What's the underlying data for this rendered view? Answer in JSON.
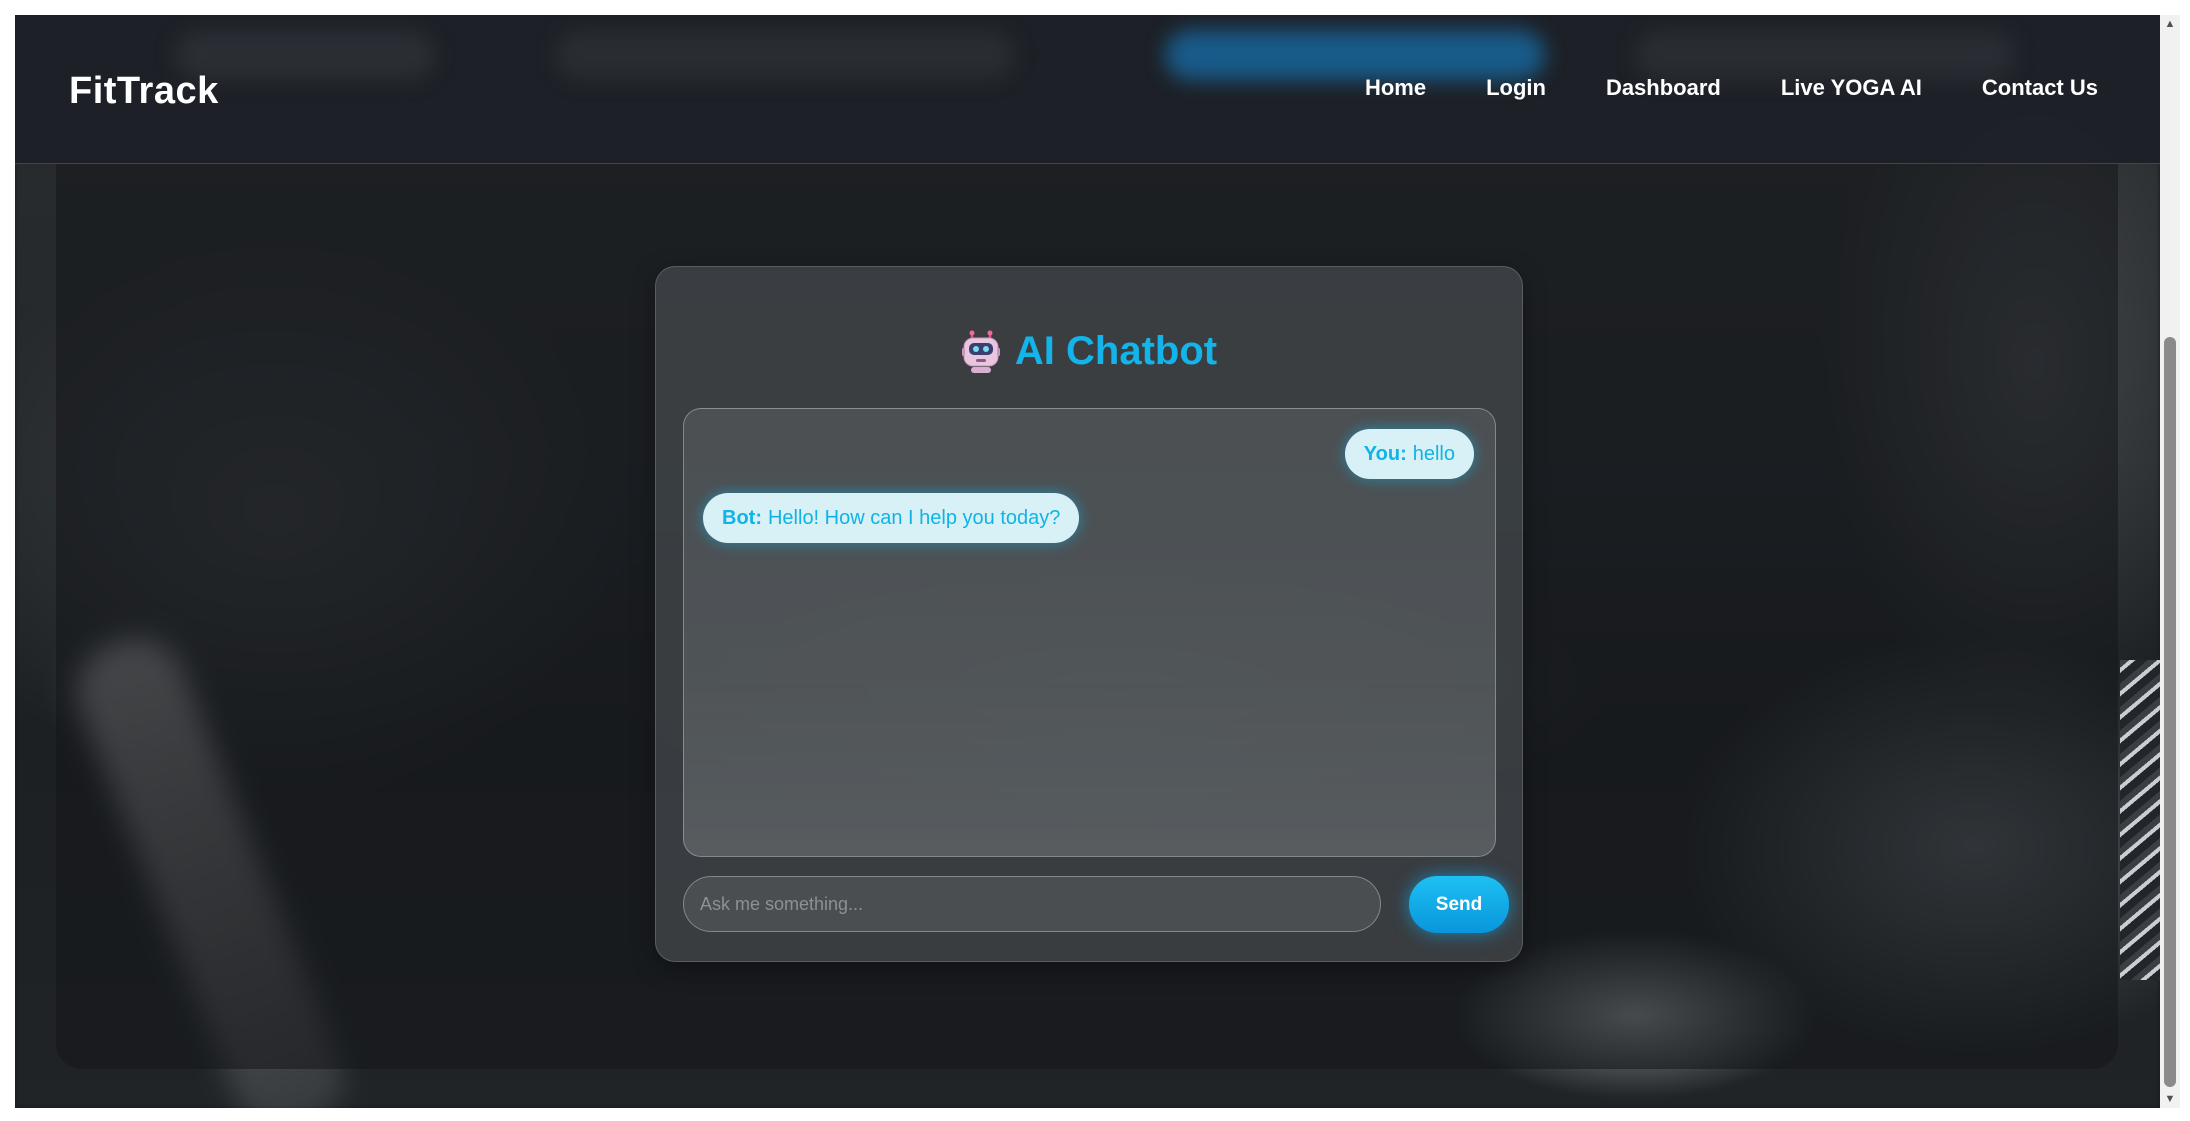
{
  "navbar": {
    "logo": "FitTrack",
    "links": [
      "Home",
      "Login",
      "Dashboard",
      "Live YOGA AI",
      "Contact Us"
    ]
  },
  "chatbot": {
    "icon": "robot-icon",
    "title": "AI Chatbot",
    "messages": [
      {
        "sender": "You:",
        "text": "hello"
      },
      {
        "sender": "Bot:",
        "text": "Hello! How can I help you today?"
      }
    ],
    "input_placeholder": "Ask me something...",
    "input_value": "",
    "send_label": "Send"
  },
  "colors": {
    "accent": "#13b4ea",
    "bubble_bg": "#d8f1f7",
    "send_button": "#0fa6e6",
    "navbar_bg": "#1c2026"
  }
}
